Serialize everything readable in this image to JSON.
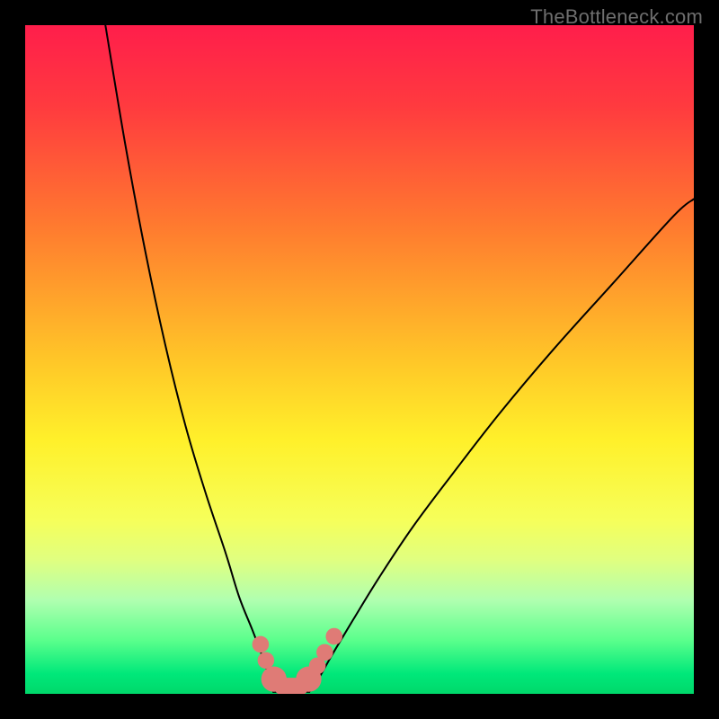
{
  "watermark": "TheBottleneck.com",
  "gradient": {
    "stops": [
      {
        "offset": "0%",
        "color": "#ff1e4b"
      },
      {
        "offset": "12%",
        "color": "#ff3a3f"
      },
      {
        "offset": "30%",
        "color": "#ff7a2f"
      },
      {
        "offset": "50%",
        "color": "#ffc628"
      },
      {
        "offset": "62%",
        "color": "#fff02a"
      },
      {
        "offset": "74%",
        "color": "#f6ff5a"
      },
      {
        "offset": "80%",
        "color": "#e0ff80"
      },
      {
        "offset": "86%",
        "color": "#b0ffb0"
      },
      {
        "offset": "92%",
        "color": "#5aff8c"
      },
      {
        "offset": "97%",
        "color": "#00e87a"
      },
      {
        "offset": "100%",
        "color": "#00d86a"
      }
    ]
  },
  "chart_data": {
    "type": "line",
    "title": "",
    "xlabel": "",
    "ylabel": "",
    "xlim": [
      0,
      100
    ],
    "ylim": [
      0,
      100
    ],
    "series": [
      {
        "name": "left-curve",
        "x": [
          12,
          15,
          18,
          21,
          24,
          27,
          30,
          32,
          34,
          35.5,
          36.5,
          37.1
        ],
        "y": [
          100,
          82,
          66,
          52,
          40,
          30,
          21,
          14.5,
          9.5,
          5.5,
          2.5,
          0.3
        ]
      },
      {
        "name": "right-curve",
        "x": [
          42.5,
          44,
          46,
          49,
          53,
          58,
          64,
          71,
          79,
          88,
          97,
          100
        ],
        "y": [
          0.3,
          2.5,
          6,
          11,
          17.5,
          25,
          33,
          42,
          51.5,
          61.5,
          71.5,
          74
        ]
      },
      {
        "name": "floor-segment",
        "x": [
          37.1,
          42.5
        ],
        "y": [
          0.3,
          0.3
        ]
      }
    ],
    "markers": [
      {
        "name": "left-marker-upper",
        "x": 35.2,
        "y": 7.4,
        "r": 1.25
      },
      {
        "name": "left-marker-lower",
        "x": 36.0,
        "y": 5.0,
        "r": 1.25
      },
      {
        "name": "right-marker-1",
        "x": 43.7,
        "y": 4.2,
        "r": 1.25
      },
      {
        "name": "right-marker-2",
        "x": 44.8,
        "y": 6.2,
        "r": 1.25
      },
      {
        "name": "right-marker-3",
        "x": 46.2,
        "y": 8.6,
        "r": 1.25
      },
      {
        "name": "valley-cap-left",
        "x": 37.2,
        "y": 2.2,
        "r": 1.9
      },
      {
        "name": "valley-cap-right",
        "x": 42.4,
        "y": 2.2,
        "r": 1.9
      }
    ],
    "valley_bar": {
      "x1": 37.2,
      "x2": 42.4,
      "y": 1.1,
      "thickness": 2.6
    },
    "marker_color": "#df7b76",
    "curve_color": "#000000"
  }
}
